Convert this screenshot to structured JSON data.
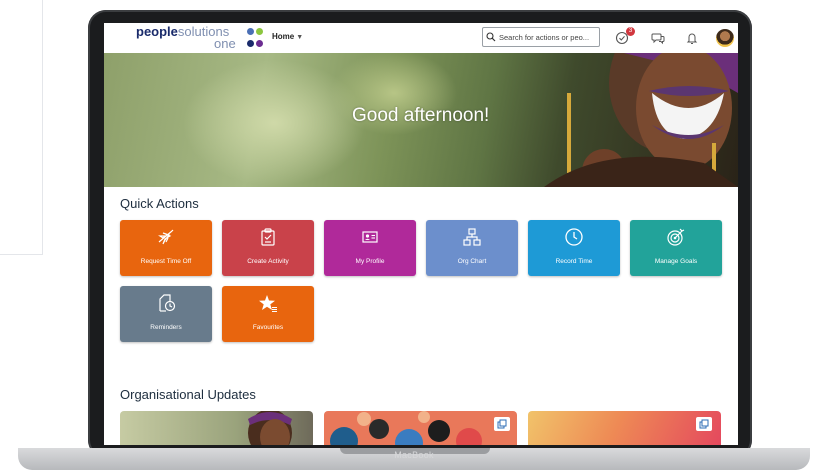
{
  "device": {
    "brand": "MacBook"
  },
  "header": {
    "logo_word1": "people",
    "logo_word2": "solutions",
    "logo_word3": "one",
    "home_label": "Home",
    "search_placeholder": "Search for actions or peo...",
    "notification_count": "3"
  },
  "hero": {
    "greeting": "Good afternoon!"
  },
  "quick_actions": {
    "title": "Quick Actions",
    "tiles": [
      {
        "label": "Request Time Off",
        "icon": "airplane-icon",
        "color": "#e8650e"
      },
      {
        "label": "Create Activity",
        "icon": "clipboard-icon",
        "color": "#c9424a"
      },
      {
        "label": "My Profile",
        "icon": "profile-card-icon",
        "color": "#b0299a"
      },
      {
        "label": "Org Chart",
        "icon": "org-chart-icon",
        "color": "#6c8fcc"
      },
      {
        "label": "Record Time",
        "icon": "clock-icon",
        "color": "#1e9ad6"
      },
      {
        "label": "Manage Goals",
        "icon": "target-icon",
        "color": "#22a39a"
      },
      {
        "label": "Reminders",
        "icon": "reminder-icon",
        "color": "#687b8c"
      },
      {
        "label": "Favourites",
        "icon": "star-icon",
        "color": "#e8650e"
      }
    ]
  },
  "updates": {
    "title": "Organisational Updates"
  },
  "colors": {
    "brand_navy": "#1a2b6b",
    "dot_blue": "#4a6fb5",
    "dot_green": "#8cc63f",
    "dot_navy": "#1a2b6b",
    "dot_purple": "#6b2c91",
    "badge_red": "#d1373f"
  }
}
